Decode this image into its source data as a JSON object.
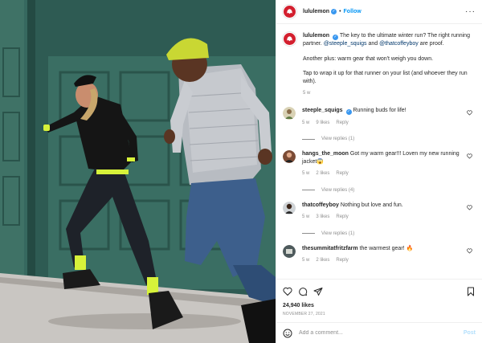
{
  "header": {
    "username": "lululemon",
    "follow_label": "Follow",
    "separator": "•"
  },
  "caption": {
    "username": "lululemon",
    "line1_text": "The key to the ultimate winter run? The right running partner.",
    "mention1": "@steeple_squigs",
    "and": "and",
    "mention2": "@thatcoffeyboy",
    "line1_end": "are proof.",
    "paragraph2": "Another plus: warm gear that won't weigh you down.",
    "paragraph3": "Tap to wrap it up for that runner on your list (and whoever they run with).",
    "age": "5 w"
  },
  "comments": [
    {
      "username": "steeple_squigs",
      "text": "Running buds for life!",
      "age": "5 w",
      "likes": "9 likes",
      "reply": "Reply",
      "view_replies": "View replies (1)"
    },
    {
      "username": "hangs_the_moon",
      "text": "Got my warm gear!!! Loven my new running jacket😱",
      "age": "5 w",
      "likes": "2 likes",
      "reply": "Reply",
      "view_replies": "View replies (4)"
    },
    {
      "username": "thatcoffeyboy",
      "text": "Nothing but love and fun.",
      "age": "5 w",
      "likes": "3 likes",
      "reply": "Reply",
      "view_replies": "View replies (1)"
    },
    {
      "username": "thesummitatfritzfarm",
      "text": "the warmest gear! 🔥",
      "age": "5 w",
      "likes": "2 likes",
      "reply": "Reply"
    }
  ],
  "actions": {
    "likes": "24,940 likes",
    "date": "NOVEMBER 27, 2021"
  },
  "add_comment": {
    "placeholder": "Add a comment...",
    "post_label": "Post"
  },
  "colors": {
    "brand": "#d31f2e",
    "link": "#0095f6",
    "muted": "#8e8e8e",
    "wall": "#2f5a52"
  },
  "icons": [
    "heart-icon",
    "comment-icon",
    "share-icon",
    "bookmark-icon",
    "emoji-icon",
    "more-icon",
    "verified-icon"
  ]
}
